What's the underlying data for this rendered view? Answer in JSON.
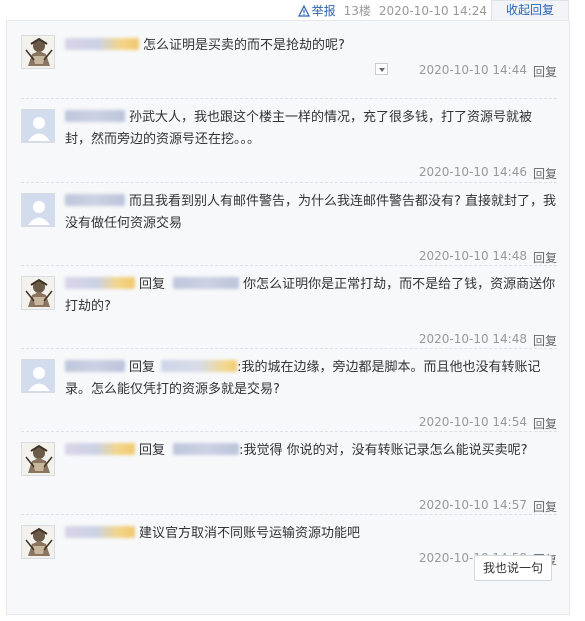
{
  "header": {
    "report_label": "举报",
    "floor": "13楼",
    "time": "2020-10-10 14:24",
    "collapse_label": "收起回复"
  },
  "reply_label": "回复",
  "replies": [
    {
      "avatar": "warrior",
      "text": "怎么证明是买卖的而不是抢劫的呢?",
      "time": "2020-10-10 14:44"
    },
    {
      "avatar": "default",
      "text": "孙武大人，我也跟这个楼主一样的情况，充了很多钱，打了资源号就被封，然而旁边的资源号还在挖。。。",
      "time": "2020-10-10 14:46"
    },
    {
      "avatar": "default",
      "text": "而且我看到别人有邮件警告，为什么我连邮件警告都没有? 直接就封了，我没有做任何资源交易",
      "time": "2020-10-10 14:48"
    },
    {
      "avatar": "warrior",
      "reply_prefix": "回复",
      "text": "你怎么证明你是正常打劫，而不是给了钱，资源商送你打劫的?",
      "time": "2020-10-10 14:48"
    },
    {
      "avatar": "default",
      "reply_prefix": "回复",
      "text": ":我的城在边缘，旁边都是脚本。而且他也没有转账记录。怎么能仅凭打的资源多就是交易?",
      "time": "2020-10-10 14:54"
    },
    {
      "avatar": "warrior",
      "reply_prefix": "回复",
      "text": ":我觉得 你说的对，没有转账记录怎么能说买卖呢?",
      "time": "2020-10-10 14:57"
    },
    {
      "avatar": "warrior",
      "text": "建议官方取消不同账号运输资源功能吧",
      "time": "2020-10-10 14:58"
    }
  ],
  "say_button": "我也说一句",
  "colors": {
    "link": "#2d64b3",
    "panel_bg": "#f7f8fa",
    "muted": "#999999"
  }
}
